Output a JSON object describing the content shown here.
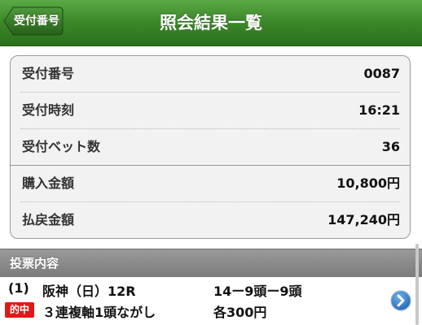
{
  "header": {
    "back_label": "受付番号",
    "title": "照会結果一覧"
  },
  "summary": {
    "rows": [
      {
        "label": "受付番号",
        "value": "0087"
      },
      {
        "label": "受付時刻",
        "value": "16:21"
      },
      {
        "label": "受付ベット数",
        "value": "36"
      },
      {
        "label": "購入金額",
        "value": "10,800円"
      },
      {
        "label": "払戻金額",
        "value": "147,240円"
      }
    ]
  },
  "votes": {
    "section_title": "投票内容",
    "items": [
      {
        "index": "(1)",
        "venue": "阪神（日）12R",
        "combination": "14ー9頭ー9頭",
        "badge": "的中",
        "bet_type": "３連複軸1頭ながし",
        "amount": "各300円"
      }
    ]
  },
  "colors": {
    "header_green": "#3d8a2a",
    "hit_red": "#e01818",
    "arrow_blue": "#2a6fc0"
  },
  "icons": {
    "back": "back-arrow-icon",
    "detail": "chevron-right-circle-icon"
  }
}
